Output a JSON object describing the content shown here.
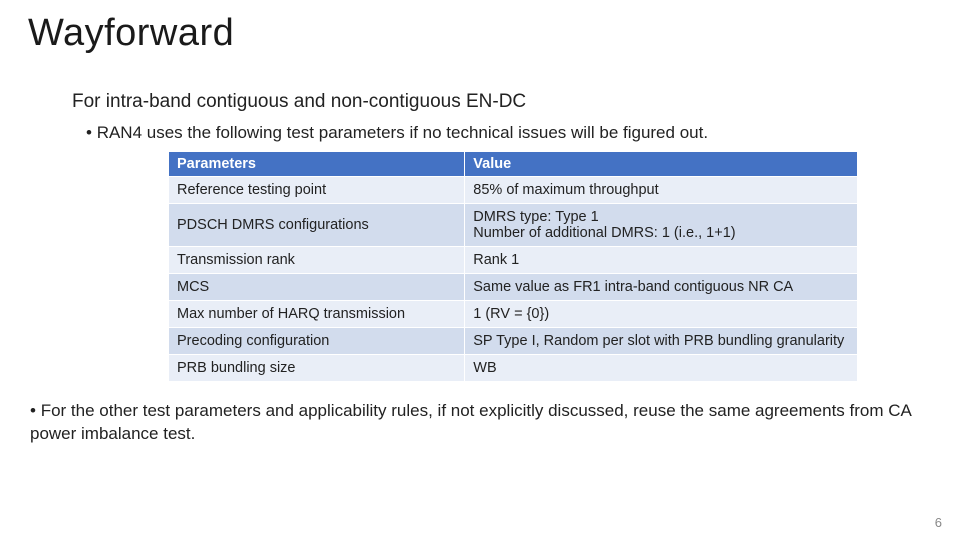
{
  "title": "Wayforward",
  "subheading": "For intra-band contiguous and non-contiguous EN-DC",
  "bullet1": "RAN4 uses the following test parameters if no technical issues will be figured out.",
  "table": {
    "headers": {
      "param": "Parameters",
      "value": "Value"
    },
    "rows": [
      {
        "param": "Reference testing point",
        "value": "85% of maximum throughput"
      },
      {
        "param": "PDSCH DMRS configurations",
        "value": "DMRS type: Type 1\nNumber of additional DMRS: 1 (i.e., 1+1)"
      },
      {
        "param": "Transmission rank",
        "value": "Rank 1"
      },
      {
        "param": "MCS",
        "value": "Same value as FR1 intra-band contiguous NR CA"
      },
      {
        "param": "Max number of HARQ transmission",
        "value": "1 (RV = {0})"
      },
      {
        "param": "Precoding configuration",
        "value": "SP Type I, Random per slot with PRB bundling granularity"
      },
      {
        "param": "PRB bundling size",
        "value": "WB"
      }
    ]
  },
  "bullet2": "For the other test parameters and applicability rules, if not explicitly discussed, reuse the same agreements from CA power imbalance test.",
  "page_number": "6"
}
